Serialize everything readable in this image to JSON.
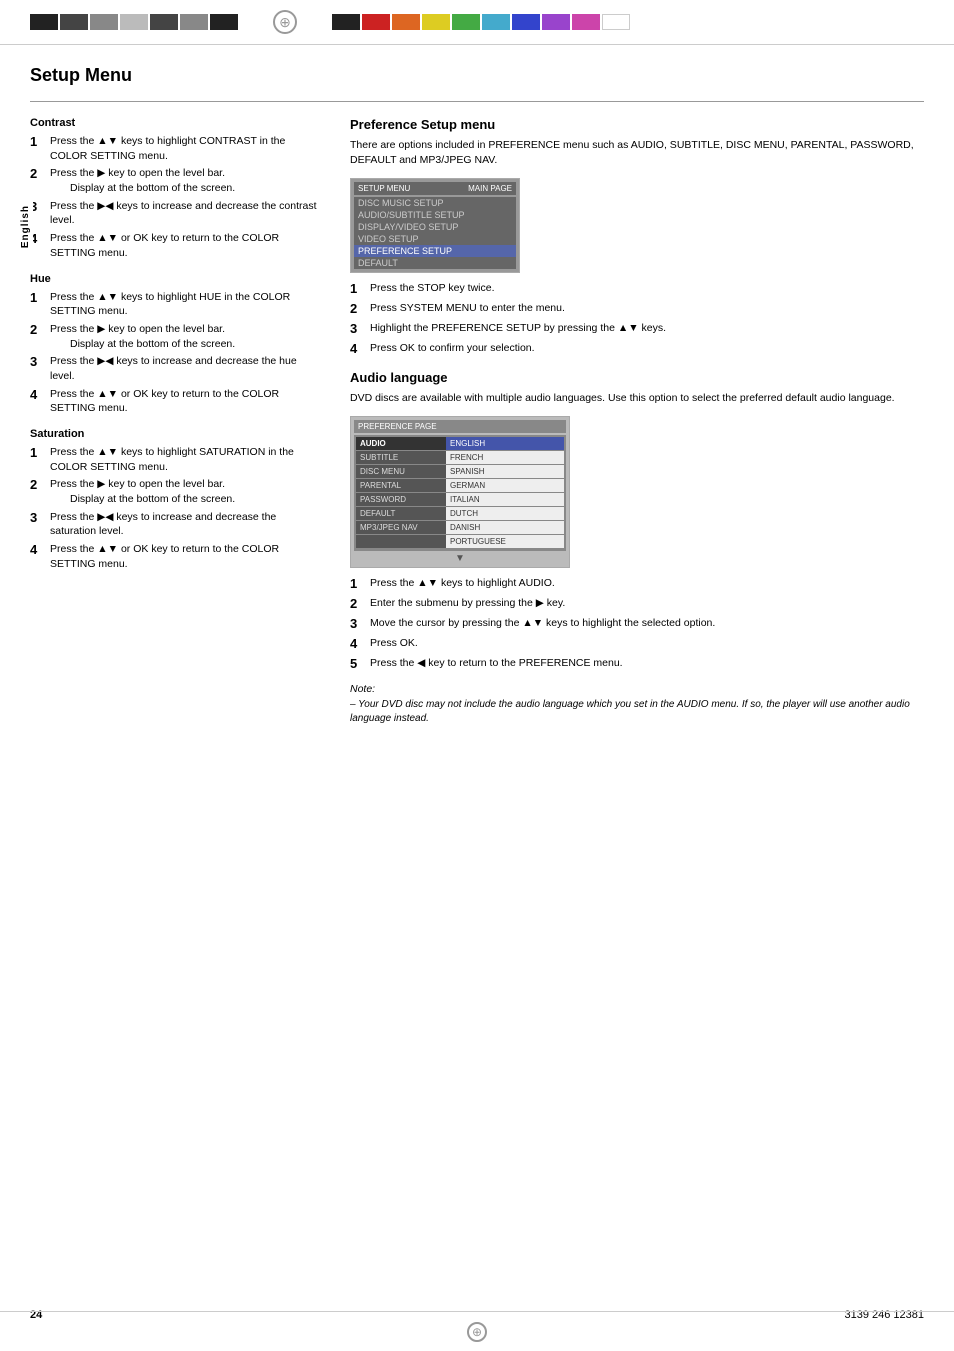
{
  "page": {
    "title": "Setup Menu",
    "page_number": "24",
    "product_code": "3139 246 12381"
  },
  "top_bar": {
    "left_blocks": [
      {
        "color": "cb-black",
        "label": "black"
      },
      {
        "color": "cb-darkgray",
        "label": "dark-gray"
      },
      {
        "color": "cb-medgray",
        "label": "med-gray"
      },
      {
        "color": "cb-lightgray",
        "label": "light-gray"
      },
      {
        "color": "cb-black",
        "label": "black2"
      },
      {
        "color": "cb-darkgray",
        "label": "dark-gray2"
      },
      {
        "color": "cb-medgray",
        "label": "med-gray2"
      }
    ],
    "right_blocks": [
      {
        "color": "cb-black",
        "label": "b1"
      },
      {
        "color": "cb-red",
        "label": "red"
      },
      {
        "color": "cb-orange",
        "label": "orange"
      },
      {
        "color": "cb-yellow",
        "label": "yellow"
      },
      {
        "color": "cb-green",
        "label": "green"
      },
      {
        "color": "cb-cyan",
        "label": "cyan"
      },
      {
        "color": "cb-blue",
        "label": "blue"
      },
      {
        "color": "cb-purple",
        "label": "purple"
      },
      {
        "color": "cb-pink",
        "label": "pink"
      },
      {
        "color": "cb-white",
        "label": "white"
      }
    ]
  },
  "sidebar": {
    "label": "English"
  },
  "left_column": {
    "sections": [
      {
        "id": "contrast",
        "heading": "Contrast",
        "steps": [
          {
            "num": "1",
            "text": "Press the ▲▼ keys to highlight CONTRAST in the COLOR SETTING menu."
          },
          {
            "num": "2",
            "text": "Press the ▶ key to open the level bar.",
            "indented": "Display at the bottom of the screen."
          },
          {
            "num": "3",
            "text": "Press the ▶◀ keys to increase and decrease the contrast level."
          },
          {
            "num": "4",
            "text": "Press the ▲▼ or OK key to return to the COLOR SETTING menu."
          }
        ]
      },
      {
        "id": "hue",
        "heading": "Hue",
        "steps": [
          {
            "num": "1",
            "text": "Press the ▲▼ keys to highlight HUE in the COLOR SETTING menu."
          },
          {
            "num": "2",
            "text": "Press the ▶ key to open the level bar.",
            "indented": "Display at the bottom of the screen."
          },
          {
            "num": "3",
            "text": "Press the ▶◀ keys to increase and decrease the hue level."
          },
          {
            "num": "4",
            "text": "Press the ▲▼ or OK key to return to the COLOR SETTING menu."
          }
        ]
      },
      {
        "id": "saturation",
        "heading": "Saturation",
        "steps": [
          {
            "num": "1",
            "text": "Press the ▲▼ keys to highlight SATURATION in the COLOR SETTING menu."
          },
          {
            "num": "2",
            "text": "Press the ▶ key to open the level bar.",
            "indented": "Display at the bottom of the screen."
          },
          {
            "num": "3",
            "text": "Press the ▶◀ keys to increase and decrease the saturation level."
          },
          {
            "num": "4",
            "text": "Press the ▲▼ or OK key to return to the COLOR SETTING menu."
          }
        ]
      }
    ]
  },
  "right_column": {
    "preference_section": {
      "heading": "Preference Setup menu",
      "intro": "There are options included in PREFERENCE menu such as AUDIO, SUBTITLE, DISC MENU, PARENTAL, PASSWORD, DEFAULT and MP3/JPEG NAV.",
      "menu": {
        "title_left": "SETUP MENU",
        "title_right": "MAIN PAGE",
        "items": [
          {
            "label": "DISC MUSIC SETUP",
            "highlighted": false
          },
          {
            "label": "AUDIO/SUBTITLE SETUP",
            "highlighted": false
          },
          {
            "label": "DISPLAY/VIDEO SETUP",
            "highlighted": false
          },
          {
            "label": "VIDEO SETUP",
            "highlighted": false
          },
          {
            "label": "PREFERENCE SETUP",
            "highlighted": true
          },
          {
            "label": "DEFAULT",
            "highlighted": false
          }
        ]
      },
      "steps": [
        {
          "num": "1",
          "text": "Press the STOP key twice."
        },
        {
          "num": "2",
          "text": "Press SYSTEM MENU to enter the menu."
        },
        {
          "num": "3",
          "text": "Highlight the PREFERENCE SETUP by pressing the ▲▼ keys."
        },
        {
          "num": "4",
          "text": "Press OK to confirm your selection."
        }
      ]
    },
    "audio_section": {
      "heading": "Audio language",
      "intro": "DVD discs are available with multiple audio languages. Use this option to select the preferred default audio language.",
      "menu": {
        "title": "PREFERENCE PAGE",
        "rows": [
          {
            "left": "AUDIO",
            "right": "ENGLISH",
            "left_highlighted": true,
            "right_highlighted": true
          },
          {
            "left": "SUBTITLE",
            "right": "FRENCH",
            "left_highlighted": false,
            "right_highlighted": false
          },
          {
            "left": "DISC MENU",
            "right": "SPANISH",
            "left_highlighted": false,
            "right_highlighted": false
          },
          {
            "left": "PARENTAL",
            "right": "GERMAN",
            "left_highlighted": false,
            "right_highlighted": false
          },
          {
            "left": "PASSWORD",
            "right": "ITALIAN",
            "left_highlighted": false,
            "right_highlighted": false
          },
          {
            "left": "DEFAULT",
            "right": "DUTCH",
            "left_highlighted": false,
            "right_highlighted": false
          },
          {
            "left": "MP3/JPEG NAV",
            "right": "DANISH",
            "left_highlighted": false,
            "right_highlighted": false
          },
          {
            "left": "",
            "right": "PORTUGUESE",
            "left_highlighted": false,
            "right_highlighted": false
          }
        ]
      },
      "steps": [
        {
          "num": "1",
          "text": "Press the ▲▼ keys to highlight AUDIO."
        },
        {
          "num": "2",
          "text": "Enter the submenu by pressing the ▶ key."
        },
        {
          "num": "3",
          "text": "Move the cursor by pressing the ▲▼ keys to highlight the selected option."
        },
        {
          "num": "4",
          "text": "Press OK."
        },
        {
          "num": "5",
          "text": "Press the ◀ key to return to the PREFERENCE menu."
        }
      ],
      "note": {
        "label": "Note:",
        "text": "– Your DVD disc may not include the audio language which you set in the AUDIO menu. If so, the player will use another audio language instead."
      }
    }
  }
}
